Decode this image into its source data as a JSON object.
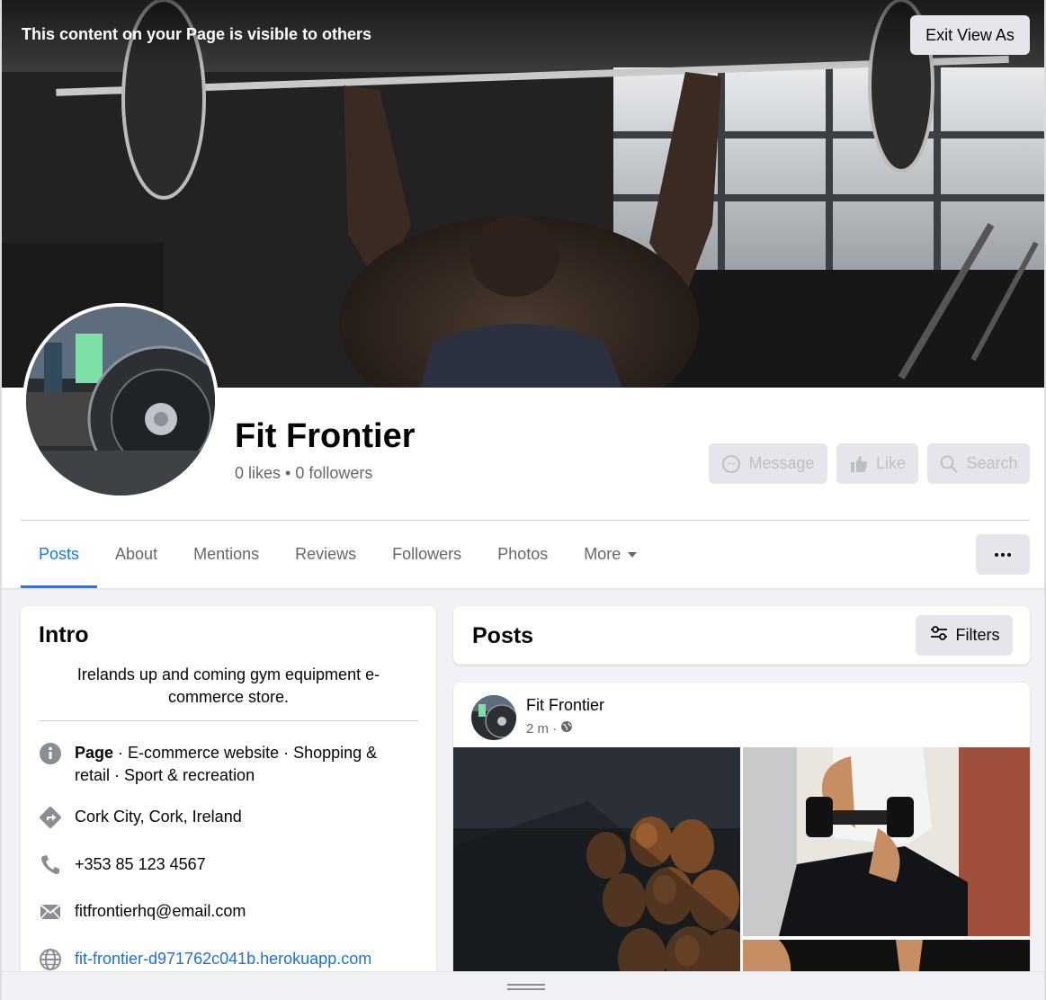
{
  "banner": {
    "view_as_text": "This content on your Page is visible to others",
    "exit_label": "Exit View As"
  },
  "profile": {
    "name": "Fit Frontier",
    "stats": "0 likes • 0 followers"
  },
  "actions": {
    "message": "Message",
    "like": "Like",
    "search": "Search"
  },
  "tabs": [
    {
      "label": "Posts"
    },
    {
      "label": "About"
    },
    {
      "label": "Mentions"
    },
    {
      "label": "Reviews"
    },
    {
      "label": "Followers"
    },
    {
      "label": "Photos"
    },
    {
      "label": "More"
    }
  ],
  "intro": {
    "title": "Intro",
    "bio": "Irelands up and coming gym equipment e-commerce store.",
    "category_bold": "Page",
    "category_rest": " · E-commerce website · Shopping & retail · Sport & recreation",
    "location": "Cork City, Cork, Ireland",
    "phone": "+353 85 123 4567",
    "email": "fitfrontierhq@email.com",
    "website": "fit-frontier-d971762c041b.herokuapp.com"
  },
  "posts_section": {
    "title": "Posts",
    "filters_label": "Filters"
  },
  "post": {
    "author": "Fit Frontier",
    "time": "2 m ·"
  },
  "colors": {
    "accent": "#1877f2",
    "link": "#216fdb",
    "button_bg": "#e4e6eb",
    "page_bg": "#f0f2f5"
  },
  "icons": {
    "info": "info-icon",
    "location": "directions-icon",
    "phone": "phone-icon",
    "email": "envelope-icon",
    "website": "globe-icon",
    "audience": "globe-icon",
    "message": "messenger-icon",
    "like": "thumbs-up-icon",
    "search": "search-icon",
    "filters": "sliders-icon",
    "more": "ellipsis-icon"
  }
}
